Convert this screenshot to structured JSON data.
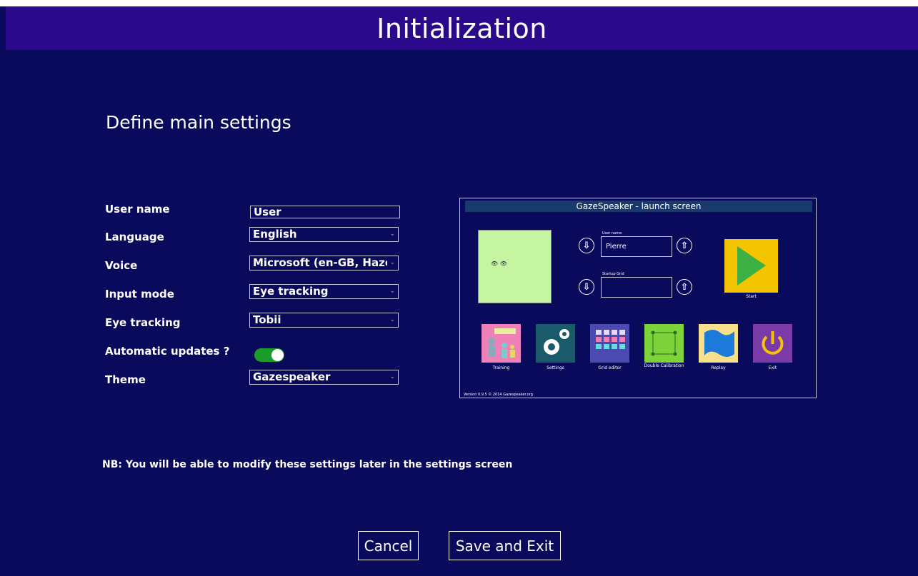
{
  "window": {
    "title": "Initialization"
  },
  "heading": "Define main settings",
  "form": {
    "user_name": {
      "label": "User name",
      "value": "User"
    },
    "language": {
      "label": "Language",
      "value": "English"
    },
    "voice": {
      "label": "Voice",
      "value": "Microsoft (en-GB, Hazel)"
    },
    "input_mode": {
      "label": "Input mode",
      "value": "Eye tracking"
    },
    "eye_tracking": {
      "label": "Eye tracking",
      "value": "Tobii"
    },
    "auto_updates": {
      "label": "Automatic updates ?",
      "on": true
    },
    "theme": {
      "label": "Theme",
      "value": "Gazespeaker"
    }
  },
  "preview": {
    "title": "GazeSpeaker - launch screen",
    "user_name_label": "User name",
    "user_name_value": "Pierre",
    "startup_grid_label": "Startup Grid",
    "start_label": "Start",
    "tiles": [
      "Training",
      "Settings",
      "Grid editor",
      "Double Calibration",
      "Replay",
      "Exit"
    ],
    "version": "Version 0.9.5 © 2014 Gazespeaker.org"
  },
  "note": "NB: You will be able to modify these settings later in the settings screen",
  "buttons": {
    "cancel": "Cancel",
    "save_exit": "Save and Exit"
  },
  "colors": {
    "background": "#0a0a5c",
    "titlebar": "#2a0a8a",
    "toggle_on": "#1a9c2a"
  }
}
